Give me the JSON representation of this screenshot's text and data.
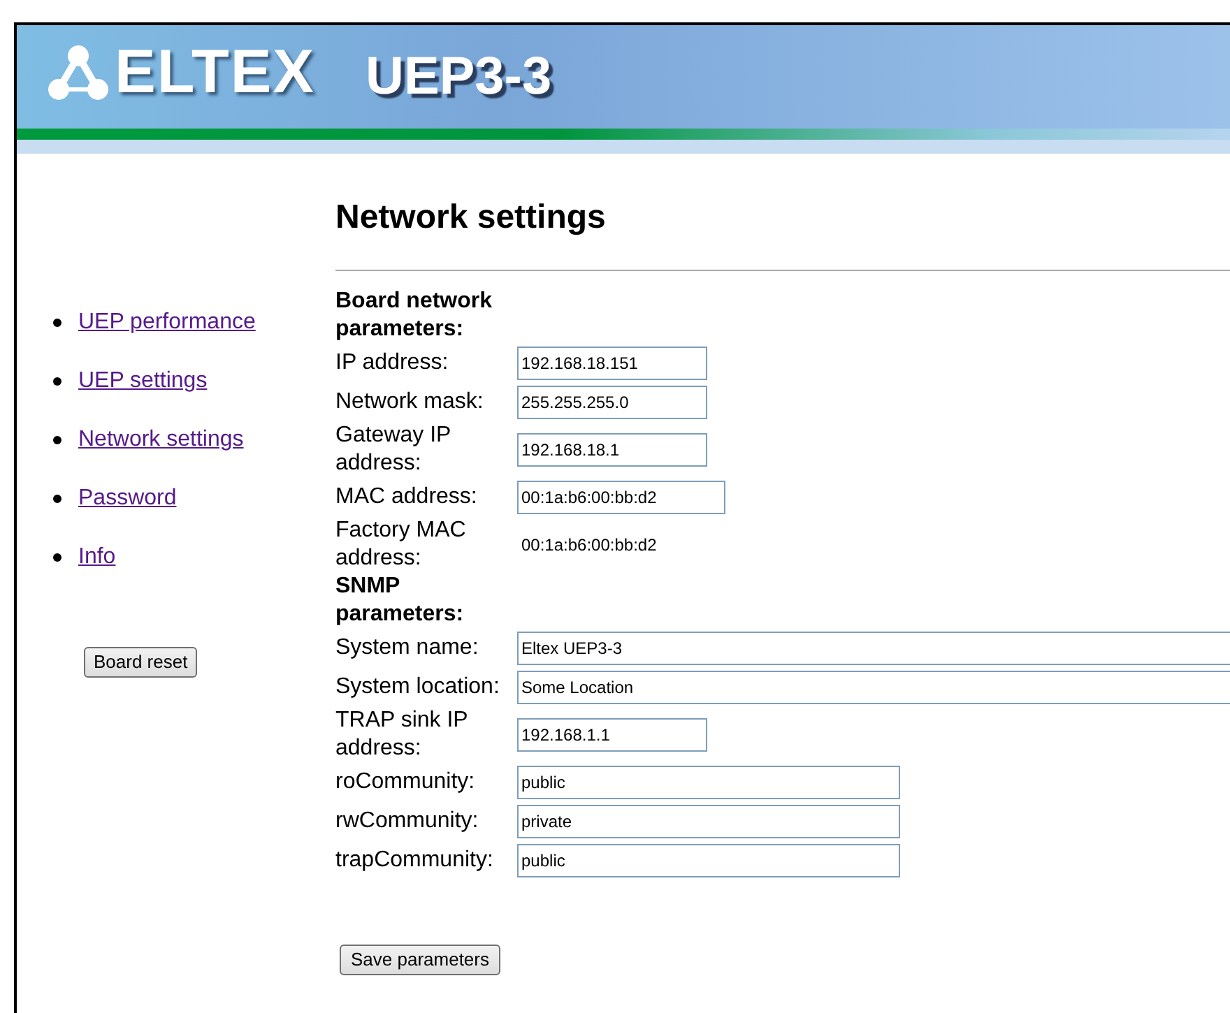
{
  "header": {
    "brand": "ELTEX",
    "model": "UEP3-3"
  },
  "sidebar": {
    "items": [
      {
        "label": "UEP performance"
      },
      {
        "label": "UEP settings"
      },
      {
        "label": "Network settings"
      },
      {
        "label": "Password"
      },
      {
        "label": "Info"
      }
    ],
    "reset_button": "Board reset"
  },
  "title": "Network settings",
  "sections": [
    {
      "heading": "Board network parameters:",
      "rows": [
        {
          "label": "IP address:",
          "kind": "input",
          "value": "192.168.18.151"
        },
        {
          "label": "Network mask:",
          "kind": "input",
          "value": "255.255.255.0"
        },
        {
          "label": "Gateway IP address:",
          "kind": "input",
          "value": "192.168.18.1"
        },
        {
          "label": "MAC address:",
          "kind": "input",
          "value": "00:1a:b6:00:bb:d2"
        },
        {
          "label": "Factory MAC address:",
          "kind": "static",
          "value": "00:1a:b6:00:bb:d2"
        }
      ]
    },
    {
      "heading": "SNMP parameters:",
      "rows": [
        {
          "label": "System name:",
          "kind": "input",
          "value": "Eltex UEP3-3"
        },
        {
          "label": "System location:",
          "kind": "input",
          "value": "Some Location"
        },
        {
          "label": "TRAP sink IP address:",
          "kind": "input",
          "value": "192.168.1.1"
        },
        {
          "label": "roCommunity:",
          "kind": "input",
          "value": "public"
        },
        {
          "label": "rwCommunity:",
          "kind": "input",
          "value": "private"
        },
        {
          "label": "trapCommunity:",
          "kind": "input",
          "value": "public"
        }
      ]
    }
  ],
  "save_button": "Save parameters"
}
